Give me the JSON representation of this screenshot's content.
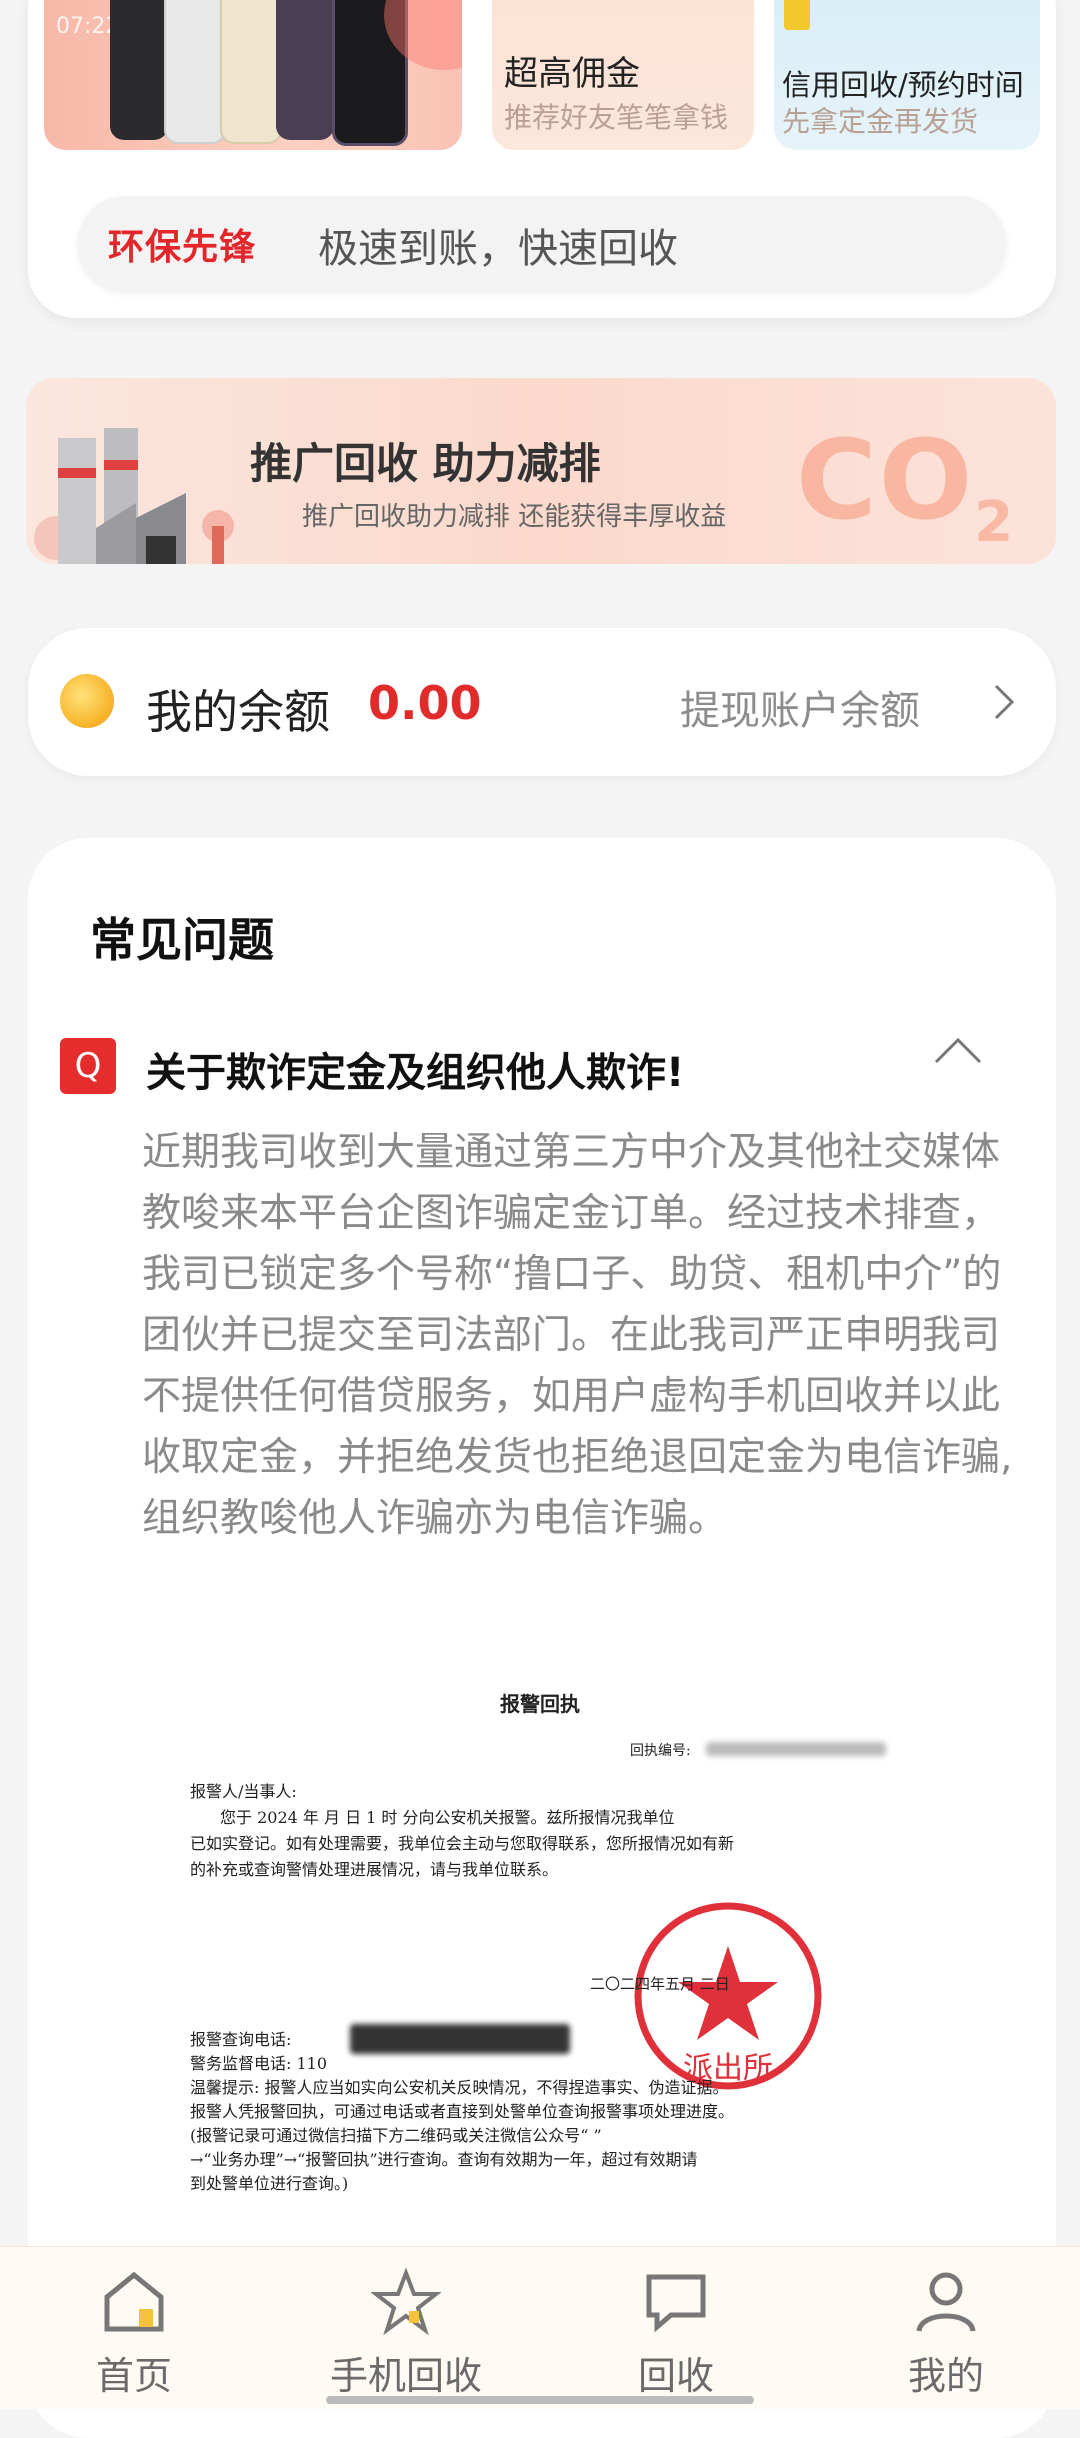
{
  "status_bar": {
    "time": "07:22"
  },
  "promos": [
    {
      "title": "",
      "subtitle": ""
    },
    {
      "title": "超高佣金",
      "subtitle": "推荐好友笔笔拿钱"
    },
    {
      "title": "信用回收/预约时间",
      "subtitle": "先拿定金再发货"
    }
  ],
  "slogan": {
    "brand": "环保先锋",
    "text": "极速到账，快速回收"
  },
  "banner": {
    "title": "推广回收 助力减排",
    "subtitle": "推广回收助力减排 还能获得丰厚收益",
    "co2_main": "CO",
    "co2_sub": "2"
  },
  "balance": {
    "label": "我的余额",
    "value": "0.00",
    "action": "提现账户余额"
  },
  "faq": {
    "title": "常见问题",
    "items": [
      {
        "badge": "Q",
        "question": "关于欺诈定金及组织他人欺诈!",
        "answer": "近期我司收到大量通过第三方中介及其他社交媒体教唆来本平台企图诈骗定金订单。经过技术排查，我司已锁定多个号称“撸口子、助贷、租机中介”的团伙并已提交至司法部门。在此我司严正申明我司不提供任何借贷服务，如用户虚构手机回收并以此收取定金，并拒绝发货也拒绝退回定金为电信诈骗,组织教唆他人诈骗亦为电信诈骗。"
      }
    ]
  },
  "document": {
    "title": "报警回执",
    "receipt_no_label": "回执编号:",
    "lines": [
      "报警人/当事人:",
      "您于 2024 年    月    日 1   时    分向公安机关报警。兹所报情况我单位",
      "已如实登记。如有处理需要，我单位会主动与您取得联系，您所报情况如有新",
      "的补充或查询警情处理进展情况，请与我单位联系。",
      "报警查询电话:",
      "警务监督电话: 110",
      "温馨提示: 报警人应当如实向公安机关反映情况，不得捏造事实、伪造证据。",
      "报警人凭报警回执，可通过电话或者直接到处警单位查询报警事项处理进度。",
      "(报警记录可通过微信扫描下方二维码或关注微信公众号“                 ”",
      "→“业务办理”→“报警回执”进行查询。查询有效期为一年，超过有效期请",
      "到处警单位进行查询。)"
    ],
    "stamp_text": "派出所",
    "stamp_date": "二〇二四年五月   二日"
  },
  "nav": [
    {
      "label": "首页",
      "icon": "home-icon"
    },
    {
      "label": "手机回收",
      "icon": "star-icon"
    },
    {
      "label": "回收",
      "icon": "chat-icon"
    },
    {
      "label": "我的",
      "icon": "user-icon"
    }
  ],
  "colors": {
    "accent": "#e12b2b",
    "brand_red": "#e4252a",
    "nav_bg": "#fffaf3"
  }
}
